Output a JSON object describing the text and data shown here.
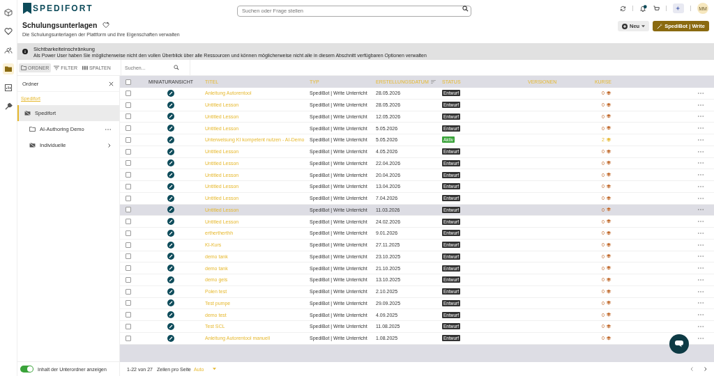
{
  "header": {
    "logo": "SPEDIFORT",
    "search_placeholder": "Suchen oder Frage stellen",
    "avatar": "MM"
  },
  "page": {
    "title": "Schulungsunterlagen",
    "subtitle": "Die Schulungsunterlagen der Plattform und ihre Eigenschaften verwalten",
    "new_button": "Neu",
    "write_button": "SpediBot | Write"
  },
  "alert": {
    "title": "Sichtbarkeiteinschränkung",
    "text": "Als Power User haben Sie möglicherweise nicht den vollen Überblick über alle Ressourcen und können möglicherweise nicht alle in diesem Abschnitt verfügbaren Optionen verwalten"
  },
  "toolbar": {
    "buttons": [
      {
        "label": "ORDNER",
        "selected": true
      },
      {
        "label": "FILTER",
        "selected": false
      },
      {
        "label": "SPALTEN",
        "selected": false
      }
    ],
    "search_placeholder": "Suchen..."
  },
  "folders": {
    "title": "Ordner",
    "breadcrumb": "Spedifort",
    "items": [
      {
        "name": "Spedifort",
        "selected": true,
        "kind": "restricted",
        "children": [
          {
            "name": "AI-Authoring Demo",
            "selected": false,
            "kind": "folder"
          },
          {
            "name": "Individuelle",
            "selected": false,
            "kind": "restricted"
          }
        ]
      }
    ],
    "toggle": {
      "label": "Inhalt der Unterordner anzeigen",
      "on": true
    }
  },
  "table": {
    "columns": [
      "MINIATURANSICHT",
      "TITEL",
      "TYP",
      "ERSTELLUNGSDATUM",
      "STATUS",
      "VERSIONEN",
      "KURSE"
    ],
    "all_checked": false,
    "rows": [
      {
        "title": "Anleitung Autorentool",
        "type": "SpediBot | Write Unterricht",
        "date": "28.05.2026",
        "status": "Entwurf",
        "color": "#333333",
        "courses": "0",
        "checked": false,
        "highlighted": false
      },
      {
        "title": "Untitled Lesson",
        "type": "SpediBot | Write Unterricht",
        "date": "28.05.2026",
        "status": "Entwurf",
        "color": "#333333",
        "courses": "0",
        "checked": false,
        "highlighted": false
      },
      {
        "title": "Untitled Lesson",
        "type": "SpediBot | Write Unterricht",
        "date": "12.05.2026",
        "status": "Entwurf",
        "color": "#333333",
        "courses": "0",
        "checked": false,
        "highlighted": false
      },
      {
        "title": "Untitled Lesson",
        "type": "SpediBot | Write Unterricht",
        "date": "5.05.2026",
        "status": "Entwurf",
        "color": "#333333",
        "courses": "0",
        "checked": false,
        "highlighted": false
      },
      {
        "title": "Unterweisung KI kompetent nutzen - AI-Demo",
        "type": "SpediBot | Write Unterricht",
        "date": "5.05.2026",
        "status": "Aktiv",
        "color": "#3aa33a",
        "courses": "2",
        "checked": false,
        "highlighted": false
      },
      {
        "title": "Untitled Lesson",
        "type": "SpediBot | Write Unterricht",
        "date": "4.05.2026",
        "status": "Entwurf",
        "color": "#333333",
        "courses": "0",
        "checked": false,
        "highlighted": false
      },
      {
        "title": "Untitled Lesson",
        "type": "SpediBot | Write Unterricht",
        "date": "22.04.2026",
        "status": "Entwurf",
        "color": "#333333",
        "courses": "0",
        "checked": false,
        "highlighted": false
      },
      {
        "title": "Untitled Lesson",
        "type": "SpediBot | Write Unterricht",
        "date": "20.04.2026",
        "status": "Entwurf",
        "color": "#333333",
        "courses": "0",
        "checked": false,
        "highlighted": false
      },
      {
        "title": "Untitled Lesson",
        "type": "SpediBot | Write Unterricht",
        "date": "13.04.2026",
        "status": "Entwurf",
        "color": "#333333",
        "courses": "0",
        "checked": false,
        "highlighted": false
      },
      {
        "title": "Untitled Lesson",
        "type": "SpediBot | Write Unterricht",
        "date": "7.04.2026",
        "status": "Entwurf",
        "color": "#333333",
        "courses": "0",
        "checked": false,
        "highlighted": false
      },
      {
        "title": "Untitled Lesson",
        "type": "SpediBot | Write Unterricht",
        "date": "11.03.2026",
        "status": "Entwurf",
        "color": "#333333",
        "courses": "0",
        "checked": false,
        "highlighted": true
      },
      {
        "title": "Untitled Lesson",
        "type": "SpediBot | Write Unterricht",
        "date": "24.02.2026",
        "status": "Entwurf",
        "color": "#333333",
        "courses": "0",
        "checked": false,
        "highlighted": false
      },
      {
        "title": "erthertherthh",
        "type": "SpediBot | Write Unterricht",
        "date": "9.01.2026",
        "status": "Entwurf",
        "color": "#333333",
        "courses": "0",
        "checked": false,
        "highlighted": false
      },
      {
        "title": "KI-Kurs",
        "type": "SpediBot | Write Unterricht",
        "date": "27.11.2025",
        "status": "Entwurf",
        "color": "#333333",
        "courses": "0",
        "checked": false,
        "highlighted": false
      },
      {
        "title": "demo tank",
        "type": "SpediBot | Write Unterricht",
        "date": "23.10.2025",
        "status": "Entwurf",
        "color": "#333333",
        "courses": "0",
        "checked": false,
        "highlighted": false
      },
      {
        "title": "demo tank",
        "type": "SpediBot | Write Unterricht",
        "date": "21.10.2025",
        "status": "Entwurf",
        "color": "#333333",
        "courses": "0",
        "checked": false,
        "highlighted": false
      },
      {
        "title": "demo geis",
        "type": "SpediBot | Write Unterricht",
        "date": "13.10.2025",
        "status": "Entwurf",
        "color": "#333333",
        "courses": "0",
        "checked": false,
        "highlighted": false
      },
      {
        "title": "Polen test",
        "type": "SpediBot | Write Unterricht",
        "date": "2.10.2025",
        "status": "Entwurf",
        "color": "#333333",
        "courses": "0",
        "checked": false,
        "highlighted": false
      },
      {
        "title": "Test pumpe",
        "type": "SpediBot | Write Unterricht",
        "date": "29.09.2025",
        "status": "Entwurf",
        "color": "#333333",
        "courses": "0",
        "checked": false,
        "highlighted": false
      },
      {
        "title": "demo test",
        "type": "SpediBot | Write Unterricht",
        "date": "4.09.2025",
        "status": "Entwurf",
        "color": "#333333",
        "courses": "0",
        "checked": false,
        "highlighted": false
      },
      {
        "title": "Test SCL",
        "type": "SpediBot | Write Unterricht",
        "date": "11.08.2025",
        "status": "Entwurf",
        "color": "#333333",
        "courses": "0",
        "checked": false,
        "highlighted": false
      },
      {
        "title": "Anleitung Autorentool manuell",
        "type": "SpediBot | Write Unterricht",
        "date": "1.08.2025",
        "status": "Entwurf",
        "color": "#333333",
        "courses": "0",
        "checked": false,
        "highlighted": false
      }
    ]
  },
  "pagination": {
    "range": "1-22 von 27",
    "rows_per_page_label": "Zeilen pro Seite",
    "rows_per_page": "Auto"
  }
}
